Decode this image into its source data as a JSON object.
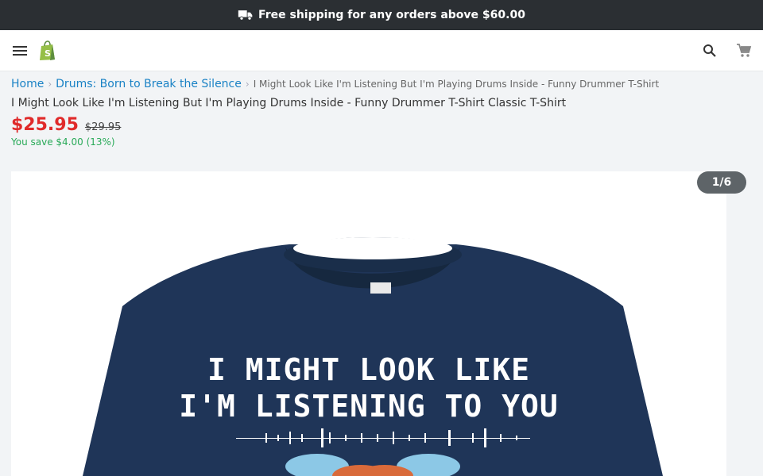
{
  "promo": {
    "text": "Free shipping for any orders above $60.00",
    "icon": "truck-icon"
  },
  "header": {
    "menu_icon": "menu-icon",
    "logo_icon": "shopify-bag-icon",
    "search_icon": "search-icon",
    "cart_icon": "cart-icon"
  },
  "breadcrumb": {
    "home": "Home",
    "collection": "Drums: Born to Break the Silence",
    "current": "I Might Look Like I'm Listening But I'm Playing Drums Inside - Funny Drummer T-Shirt"
  },
  "product": {
    "title": "I Might Look Like I'm Listening But I'm Playing Drums Inside - Funny Drummer T-Shirt Classic T-Shirt",
    "price": "$25.95",
    "compare_price": "$29.95",
    "savings": "You save $4.00 (13%)"
  },
  "gallery": {
    "counter": "1/6",
    "shirt_line1": "I MIGHT LOOK LIKE",
    "shirt_line2": "I'M LISTENING TO YOU"
  },
  "colors": {
    "promo_bg": "#2b2f33",
    "price": "#e02a2a",
    "link": "#1a82c5",
    "savings": "#2aaa59",
    "shirt": "#1f3558"
  }
}
